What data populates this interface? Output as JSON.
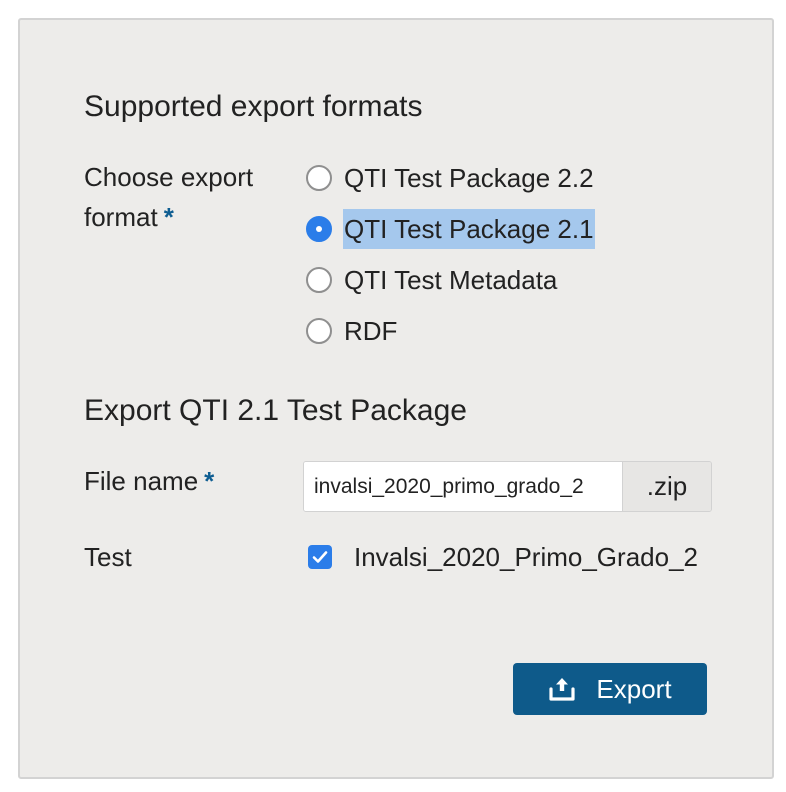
{
  "formats_section": {
    "title": "Supported export formats",
    "field_label": "Choose export format",
    "required_marker": "*",
    "options": [
      {
        "label": "QTI Test Package 2.2",
        "checked": false
      },
      {
        "label": "QTI Test Package 2.1",
        "checked": true
      },
      {
        "label": "QTI Test Metadata",
        "checked": false
      },
      {
        "label": "RDF",
        "checked": false
      }
    ]
  },
  "export_section": {
    "title": "Export QTI 2.1 Test Package",
    "file_name_label": "File name",
    "required_marker": "*",
    "file_name_value": "invalsi_2020_primo_grado_2",
    "file_suffix": ".zip",
    "test_label": "Test",
    "test_item_label": "Invalsi_2020_Primo_Grado_2",
    "test_item_checked": true
  },
  "actions": {
    "export_label": "Export",
    "export_icon": "export-icon"
  },
  "colors": {
    "accent": "#2b7de9",
    "button": "#0e5a8a",
    "required": "#0e5d91",
    "selection_highlight": "#a5c8ed",
    "panel_background": "#edecea"
  }
}
